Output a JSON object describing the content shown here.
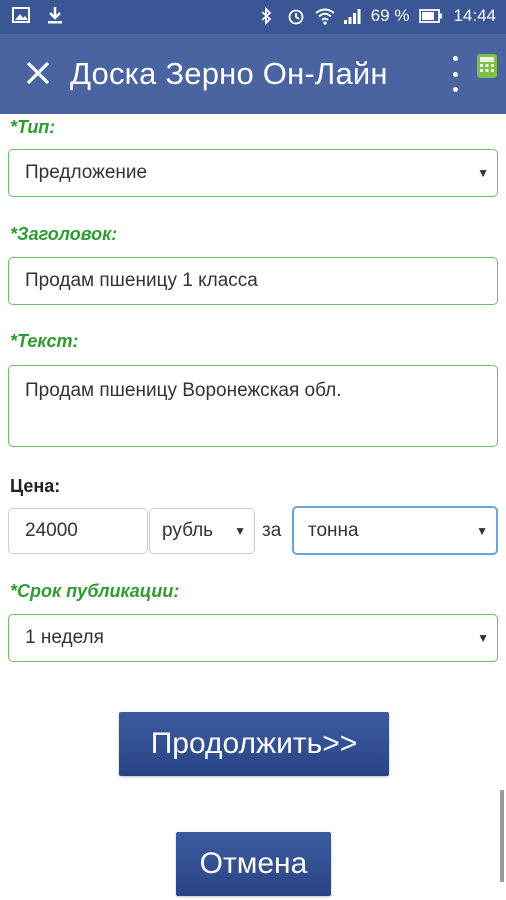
{
  "status": {
    "battery_percent": "69 %",
    "time": "14:44"
  },
  "app": {
    "title": "Доска Зерно Он-Лайн"
  },
  "form": {
    "type_label": "*Тип:",
    "type_value": "Предложение",
    "title_label": "*Заголовок:",
    "title_value": "Продам пшеницу 1 класса",
    "text_label": "*Текст:",
    "text_value": "Продам пшеницу Воронежская обл.",
    "price_label": "Цена:",
    "price_value": "24000",
    "currency_value": "рубль",
    "per_label": "за",
    "unit_value": "тонна",
    "period_label": "*Срок публикации:",
    "period_value": "1 неделя"
  },
  "buttons": {
    "continue_label": "Продолжить>>",
    "cancel_label": "Отмена"
  },
  "colors": {
    "accent_green": "#2e9c2e",
    "header_blue": "#4a64a2",
    "button_blue": "#2f4d8f"
  }
}
